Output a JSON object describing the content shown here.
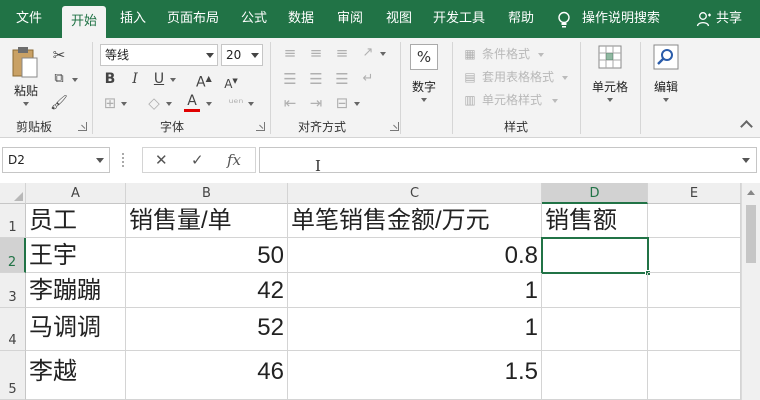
{
  "tabs": [
    {
      "label": "文件"
    },
    {
      "label": "开始"
    },
    {
      "label": "插入"
    },
    {
      "label": "页面布局"
    },
    {
      "label": "公式"
    },
    {
      "label": "数据"
    },
    {
      "label": "审阅"
    },
    {
      "label": "视图"
    },
    {
      "label": "开发工具"
    },
    {
      "label": "帮助"
    }
  ],
  "active_tab": "开始",
  "tell_me": "操作说明搜索",
  "share": "共享",
  "ribbon": {
    "clipboard": {
      "paste_label": "粘贴",
      "group_label": "剪贴板"
    },
    "font": {
      "font_name": "等线",
      "font_size": "20",
      "bold": "B",
      "italic": "I",
      "underline": "U",
      "grow": "A",
      "shrink": "A",
      "group_label": "字体",
      "font_color": "#e00000"
    },
    "alignment": {
      "group_label": "对齐方式"
    },
    "number": {
      "label": "数字",
      "icon": "%"
    },
    "styles": {
      "conditional": "条件格式",
      "table": "套用表格格式",
      "cell_styles": "单元格样式",
      "group_label": "样式"
    },
    "cells": {
      "label": "单元格"
    },
    "editing": {
      "label": "编辑"
    }
  },
  "formula_bar": {
    "name_box": "D2",
    "cancel": "✕",
    "enter": "✓",
    "fx": "fx",
    "value": ""
  },
  "sheet": {
    "columns": [
      "A",
      "B",
      "C",
      "D",
      "E"
    ],
    "selected_column": "D",
    "rows": [
      "1",
      "2",
      "3",
      "4",
      "5"
    ],
    "selected_row": "2",
    "cells": [
      [
        "员工",
        "销售量/单",
        "单笔销售金额/万元",
        "销售额",
        ""
      ],
      [
        "王宇",
        "50",
        "0.8",
        "",
        ""
      ],
      [
        "李蹦蹦",
        "42",
        "1",
        "",
        ""
      ],
      [
        "马调调",
        "52",
        "1",
        "",
        ""
      ],
      [
        "李越",
        "46",
        "1.5",
        "",
        ""
      ]
    ],
    "active_cell": "D2",
    "accent": "#217346"
  }
}
